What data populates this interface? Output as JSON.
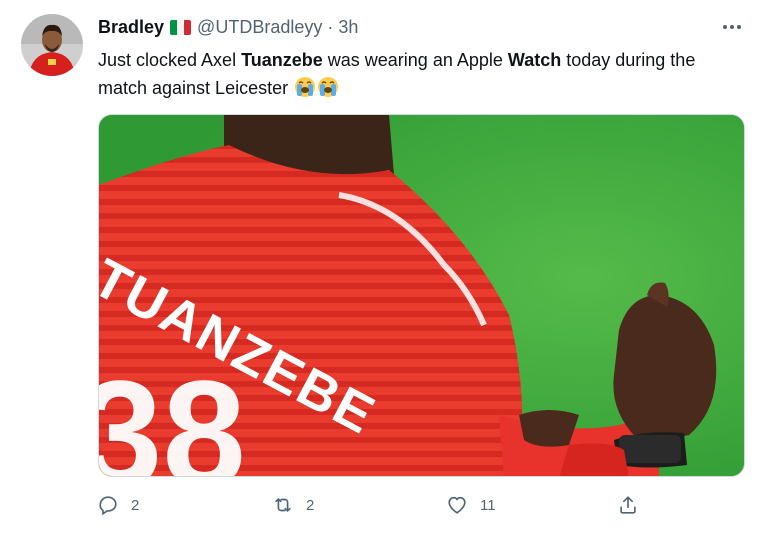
{
  "tweet": {
    "author": {
      "name": "Bradley",
      "flag_icon": "italy-flag-icon",
      "flag_colors": [
        "#009246",
        "#ffffff",
        "#ce2b37"
      ],
      "handle": "@UTDBradleyy",
      "separator": "·",
      "time": "3h"
    },
    "text": {
      "part1": "Just clocked Axel ",
      "bold1": "Tuanzebe",
      "part2": " was wearing an Apple ",
      "bold2": "Watch",
      "part3": " today during the match against Leicester",
      "emojis": [
        "loudly-crying-face-icon",
        "loudly-crying-face-icon"
      ]
    },
    "media": {
      "shirt_lettering": "TUANZEBE",
      "shirt_number": "38"
    },
    "actions": {
      "reply": {
        "icon": "reply-icon",
        "count": "2"
      },
      "retweet": {
        "icon": "retweet-icon",
        "count": "2"
      },
      "like": {
        "icon": "heart-icon",
        "count": "11"
      },
      "share": {
        "icon": "share-icon",
        "count": ""
      }
    },
    "colors": {
      "text_primary": "#0f1419",
      "text_secondary": "#536471",
      "shirt_red": "#e8322c",
      "pitch_green": "#3aa53a"
    }
  }
}
